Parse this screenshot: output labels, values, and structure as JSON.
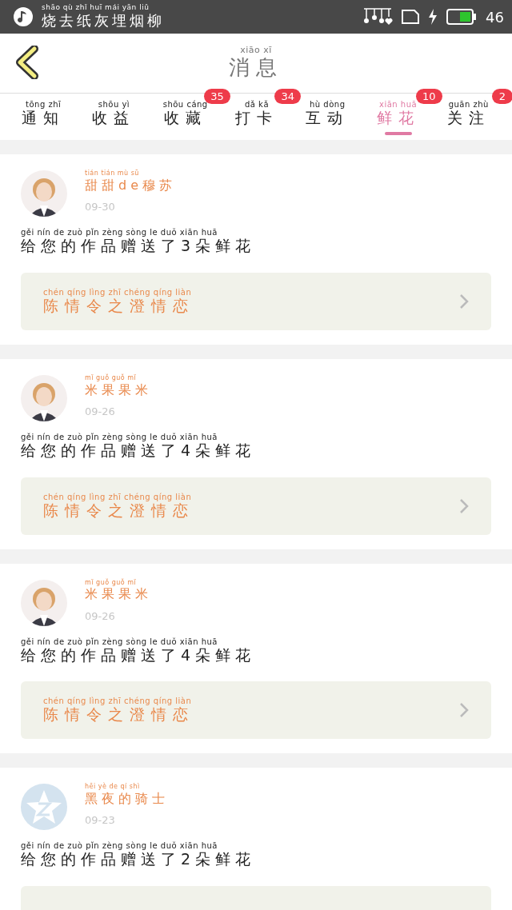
{
  "status_bar": {
    "song": {
      "text": "烧去纸灰埋烟柳",
      "pinyin": "shāo qù zhǐ huī mái yān liǔ"
    },
    "signal": "46"
  },
  "header": {
    "title": {
      "text": "消息",
      "pinyin": "xiāo xī"
    }
  },
  "tabs": [
    {
      "text": "通知",
      "pinyin": "tōng zhī",
      "selected": false
    },
    {
      "text": "收益",
      "pinyin": "shōu yì",
      "selected": false
    },
    {
      "text": "收藏",
      "pinyin": "shōu cáng",
      "selected": false,
      "badge": "35"
    },
    {
      "text": "打卡",
      "pinyin": "dǎ kǎ",
      "selected": false,
      "badge": "34"
    },
    {
      "text": "互动",
      "pinyin": "hù dòng",
      "selected": false
    },
    {
      "text": "鲜花",
      "pinyin": "xiān huā",
      "selected": true,
      "badge": "10"
    },
    {
      "text": "关注",
      "pinyin": "guān zhù",
      "selected": false,
      "badge": "2"
    }
  ],
  "messages": [
    {
      "user": {
        "text": "甜甜de穆苏",
        "pinyin": "tián tián mù sū"
      },
      "date": "09-30",
      "body": {
        "text": "给您的作品赠送了3朵鲜花",
        "pinyin": "gěi nín de zuò pǐn zèng sòng le duǒ xiān huā"
      },
      "work": {
        "text": "陈情令之澄情恋",
        "pinyin": "chén qíng lìng zhī chéng qíng liàn"
      }
    },
    {
      "user": {
        "text": "米果果米",
        "pinyin": "mǐ guǒ guǒ mǐ"
      },
      "date": "09-26",
      "body": {
        "text": "给您的作品赠送了4朵鲜花",
        "pinyin": "gěi nín de zuò pǐn zèng sòng le duǒ xiān huā"
      },
      "work": {
        "text": "陈情令之澄情恋",
        "pinyin": "chén qíng lìng zhī chéng qíng liàn"
      }
    },
    {
      "user": {
        "text": "米果果米",
        "pinyin": "mǐ guǒ guǒ mǐ"
      },
      "date": "09-26",
      "body": {
        "text": "给您的作品赠送了4朵鲜花",
        "pinyin": "gěi nín de zuò pǐn zèng sòng le duǒ xiān huā"
      },
      "work": {
        "text": "陈情令之澄情恋",
        "pinyin": "chén qíng lìng zhī chéng qíng liàn"
      }
    },
    {
      "avatar": {
        "kind": "default"
      },
      "user": {
        "text": "黑夜的骑士",
        "pinyin": "hēi yè de qí shì"
      },
      "date": "09-23",
      "body": {
        "text": "给您的作品赠送了2朵鲜花",
        "pinyin": "gěi nín de zuò pǐn zèng sòng le duǒ xiān huā"
      }
    }
  ]
}
